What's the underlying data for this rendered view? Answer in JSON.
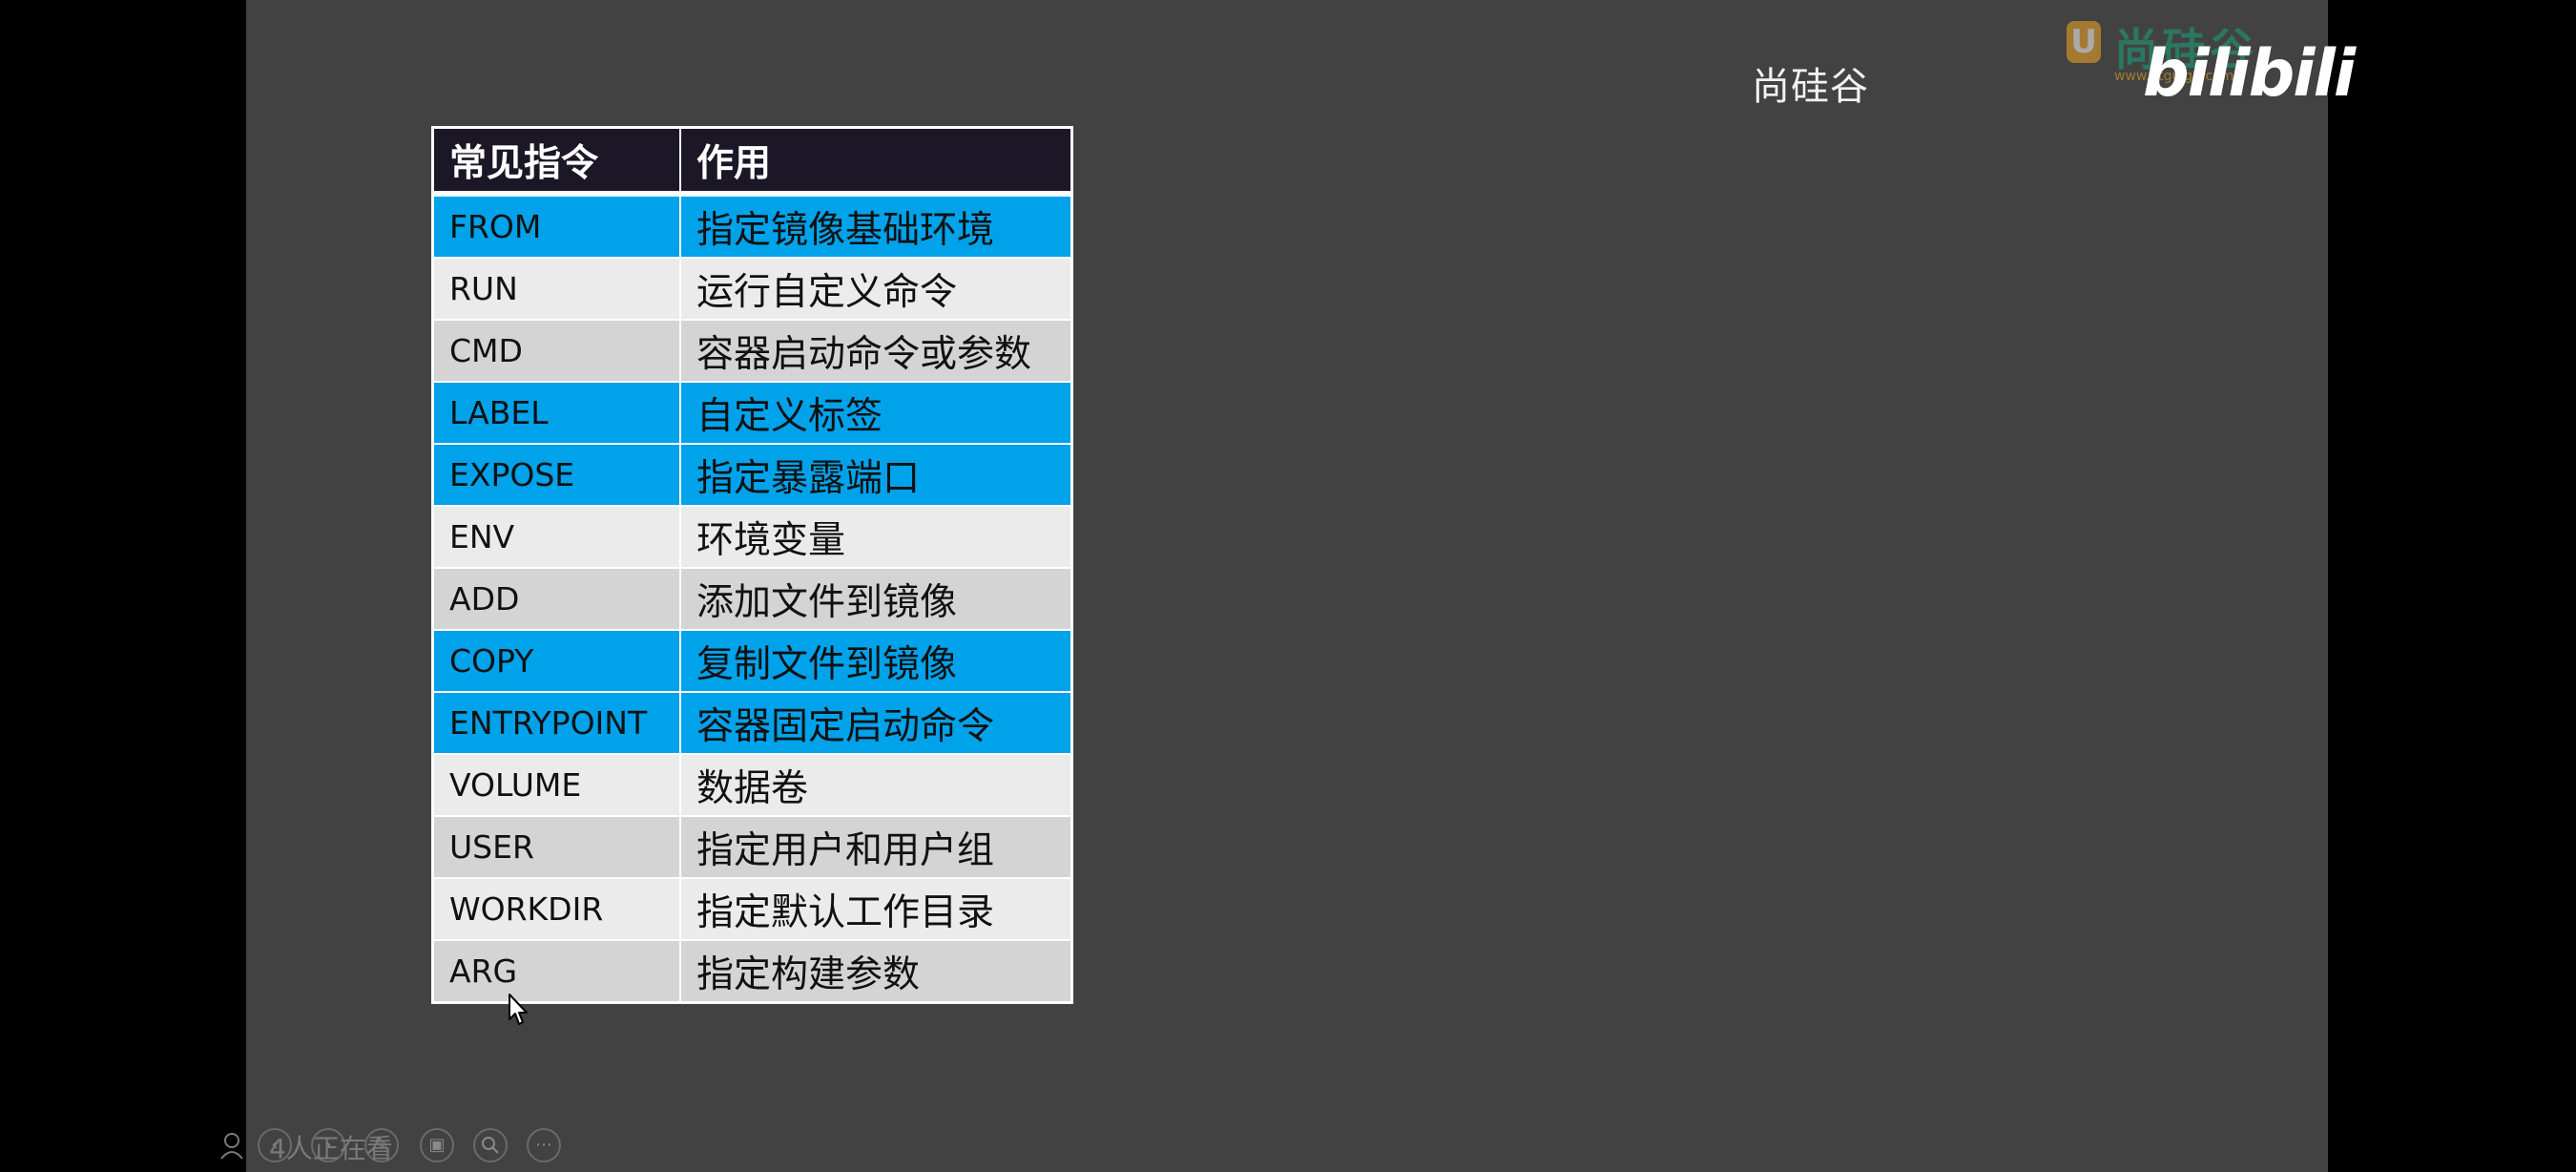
{
  "watermark": {
    "logo_text": "尚硅谷",
    "logo_url": "www.atguigu.com",
    "brand": "尚硅谷",
    "platform": "bilibili"
  },
  "table": {
    "headers": [
      "常见指令",
      "作用"
    ],
    "rows": [
      {
        "cmd": "FROM",
        "desc": "指定镜像基础环境",
        "style": "blue"
      },
      {
        "cmd": "RUN",
        "desc": "运行自定义命令",
        "style": "light"
      },
      {
        "cmd": "CMD",
        "desc": "容器启动命令或参数",
        "style": "mid"
      },
      {
        "cmd": "LABEL",
        "desc": "自定义标签",
        "style": "blue"
      },
      {
        "cmd": "EXPOSE",
        "desc": "指定暴露端口",
        "style": "blue"
      },
      {
        "cmd": "ENV",
        "desc": "环境变量",
        "style": "light"
      },
      {
        "cmd": "ADD",
        "desc": "添加文件到镜像",
        "style": "mid"
      },
      {
        "cmd": "COPY",
        "desc": "复制文件到镜像",
        "style": "blue"
      },
      {
        "cmd": "ENTRYPOINT",
        "desc": "容器固定启动命令",
        "style": "blue"
      },
      {
        "cmd": "VOLUME",
        "desc": "数据卷",
        "style": "light"
      },
      {
        "cmd": "USER",
        "desc": "指定用户和用户组",
        "style": "mid"
      },
      {
        "cmd": "WORKDIR",
        "desc": "指定默认工作目录",
        "style": "light"
      },
      {
        "cmd": "ARG",
        "desc": "指定构建参数",
        "style": "mid"
      }
    ]
  },
  "toolbar": {
    "viewers_text": "4人正在看",
    "buttons": [
      "prev",
      "next",
      "pen",
      "slides",
      "zoom",
      "more"
    ]
  },
  "colors": {
    "slide_bg": "#424242",
    "header_bg": "#1b1727",
    "highlight_blue": "#00a2ea",
    "row_light": "#ebebeb",
    "row_mid": "#d4d4d4"
  }
}
